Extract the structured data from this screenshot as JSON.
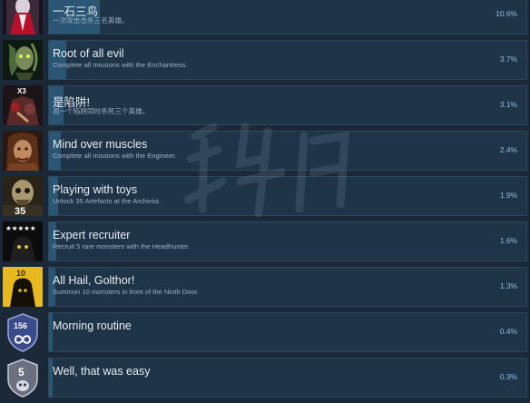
{
  "achievements": [
    {
      "title": "一石三鸟",
      "description": "一次攻击击杀三名英雄。",
      "percent": "10.6%",
      "rarity": 0.106,
      "icon": "sorceress-icon",
      "badge": ""
    },
    {
      "title": "Root of all evil",
      "description": "Complete all missions with the Enchantress.",
      "percent": "3.7%",
      "rarity": 0.037,
      "icon": "enchantress-icon",
      "badge": ""
    },
    {
      "title": "是陷阱!",
      "description": "用一个陷阱同时杀死三个英雄。",
      "percent": "3.1%",
      "rarity": 0.031,
      "icon": "trap-icon",
      "badge": "X3"
    },
    {
      "title": "Mind over muscles",
      "description": "Complete all missions with the Engineer.",
      "percent": "2.4%",
      "rarity": 0.024,
      "icon": "engineer-icon",
      "badge": ""
    },
    {
      "title": "Playing with toys",
      "description": "Unlock 35 Artefacts at the Archivist.",
      "percent": "1.9%",
      "rarity": 0.019,
      "icon": "archivist-icon",
      "badge": "35"
    },
    {
      "title": "Expert recruiter",
      "description": "Recruit 5 rare monsters with the Headhunter.",
      "percent": "1.6%",
      "rarity": 0.016,
      "icon": "headhunter-icon",
      "badge": "★★★★★"
    },
    {
      "title": "All Hail, Golthor!",
      "description": "Summon 10 monsters in front of the Ninth Door.",
      "percent": "1.3%",
      "rarity": 0.013,
      "icon": "golthor-icon",
      "badge": "10"
    },
    {
      "title": "Morning routine",
      "description": "",
      "percent": "0.4%",
      "rarity": 0.004,
      "icon": "infinity-shield-icon",
      "badge": "156"
    },
    {
      "title": "Well, that was easy",
      "description": "",
      "percent": "0.3%",
      "rarity": 0.003,
      "icon": "skull-shield-icon",
      "badge": "5"
    }
  ],
  "colors": {
    "background": "#1b2838",
    "bar": "#1f3447",
    "fill": "#2a5573",
    "percent_text": "#8fbee6"
  }
}
